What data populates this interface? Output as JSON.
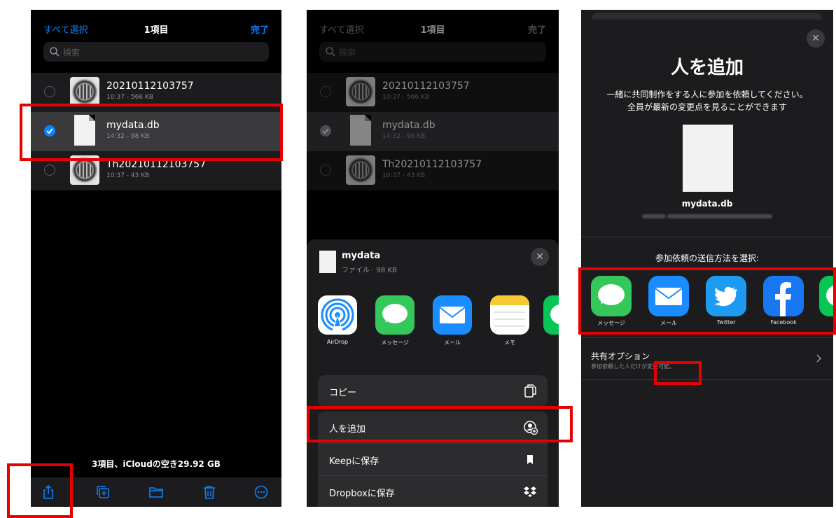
{
  "colors": {
    "accent": "#0a84ff",
    "highlight": "#e60000",
    "panel_bg": "#000000",
    "sheet_bg": "#1c1c1e"
  },
  "files_screen": {
    "select_all": "すべて選択",
    "title": "1項目",
    "done": "完了",
    "search_placeholder": "検索",
    "files": [
      {
        "name": "20210112103757",
        "meta": "10:37 - 566 KB",
        "thumb": "image",
        "selected": false
      },
      {
        "name": "mydata.db",
        "meta": "14:32 - 98 KB",
        "thumb": "document",
        "selected": true
      },
      {
        "name": "Th20210112103757",
        "meta": "10:37 - 43 KB",
        "thumb": "image",
        "selected": false
      }
    ],
    "footer": "3項目、iCloudの空き29.92 GB",
    "toolbar": [
      "share-icon",
      "duplicate-icon",
      "folder-icon",
      "trash-icon",
      "more-icon"
    ]
  },
  "share_sheet": {
    "file_title": "mydata",
    "file_subtitle": "ファイル · 98 KB",
    "close": "✕",
    "apps": [
      {
        "label": "AirDrop",
        "icon": "airdrop-icon"
      },
      {
        "label": "メッセージ",
        "icon": "messages-icon"
      },
      {
        "label": "メール",
        "icon": "mail-icon"
      },
      {
        "label": "メモ",
        "icon": "notes-icon"
      }
    ],
    "actions": [
      {
        "label": "コピー",
        "icon": "copy-icon"
      },
      {
        "label": "人を追加",
        "icon": "add-person-icon"
      },
      {
        "label": "Keepに保存",
        "icon": "bookmark-icon"
      },
      {
        "label": "Dropboxに保存",
        "icon": "dropbox-icon"
      }
    ]
  },
  "add_people": {
    "close": "✕",
    "title": "人を追加",
    "description_line1": "一緒に共同制作をする人に参加を依頼してください。",
    "description_line2": "全員が最新の変更点を見ることができます",
    "file_name": "mydata.db",
    "choose_method": "参加依頼の送信方法を選択:",
    "share_apps": [
      {
        "label": "メッセージ",
        "icon": "messages-icon"
      },
      {
        "label": "メール",
        "icon": "mail-icon"
      },
      {
        "label": "Twitter",
        "icon": "twitter-icon"
      },
      {
        "label": "Facebook",
        "icon": "facebook-icon"
      }
    ],
    "options_title": "共有オプション",
    "options_subtitle": "参加依頼した人だけが変更可能。"
  }
}
